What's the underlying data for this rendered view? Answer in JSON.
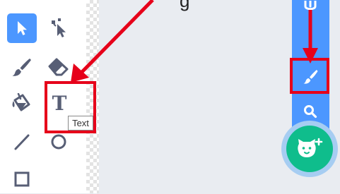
{
  "palette": {
    "tooltip": "Text",
    "tools": [
      {
        "name": "select",
        "icon": "arrow-pointer-icon",
        "selected": true
      },
      {
        "name": "reshape",
        "icon": "reshape-pointer-icon",
        "selected": false
      },
      {
        "name": "brush",
        "icon": "brush-icon",
        "selected": false
      },
      {
        "name": "eraser",
        "icon": "eraser-icon",
        "selected": false
      },
      {
        "name": "fill",
        "icon": "paint-bucket-icon",
        "selected": false
      },
      {
        "name": "text",
        "icon": "text-icon",
        "glyph": "T",
        "selected": false
      },
      {
        "name": "line",
        "icon": "line-icon",
        "selected": false
      },
      {
        "name": "circle",
        "icon": "circle-icon",
        "selected": false
      },
      {
        "name": "rectangle",
        "icon": "rectangle-icon",
        "selected": false
      }
    ]
  },
  "sidebar": {
    "items": [
      {
        "name": "upload",
        "icon": "upload-icon"
      },
      {
        "name": "paint",
        "icon": "paintbrush-icon"
      },
      {
        "name": "search",
        "icon": "search-icon"
      }
    ]
  },
  "fab": {
    "icon": "cat-plus-icon"
  },
  "annotation": {
    "caption_fragment": "g",
    "color": "#e6001a"
  },
  "colors": {
    "accent": "#4c97ff",
    "icon": "#575e75",
    "fab": "#0fbd8c",
    "highlight": "#e6001a"
  }
}
